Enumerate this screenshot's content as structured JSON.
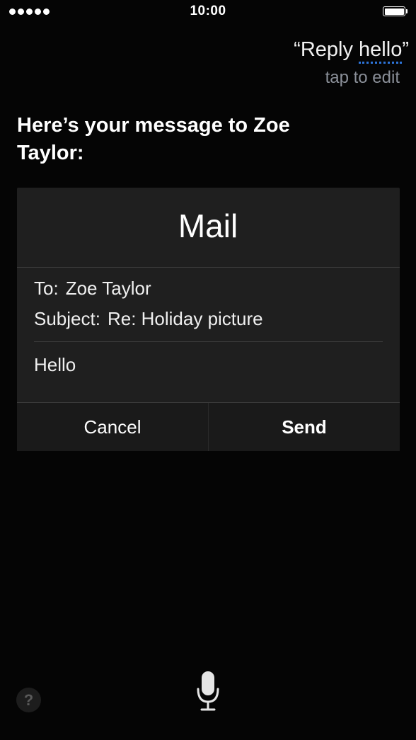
{
  "status_bar": {
    "time": "10:00",
    "signal_bars": 5,
    "battery_level": 1.0,
    "icons": [
      "signal-dots-icon",
      "battery-icon"
    ]
  },
  "siri": {
    "utterance_open_quote": "“",
    "utterance_prefix": "Reply ",
    "utterance_word": "hello",
    "utterance_close_quote": "”",
    "tap_to_edit": "tap to edit",
    "response": "Here’s your message to Zoe Taylor:"
  },
  "mail_card": {
    "title": "Mail",
    "to_label": "To:",
    "to_value": "Zoe Taylor",
    "subject_label": "Subject:",
    "subject_value": "Re: Holiday picture",
    "body": "Hello",
    "cancel_label": "Cancel",
    "send_label": "Send"
  },
  "bottom": {
    "help_label": "?",
    "icons": [
      "help-icon",
      "microphone-icon"
    ]
  },
  "colors": {
    "background": "#050505",
    "card": "#1f1f1f",
    "uncertain_underline": "#2d74d9",
    "secondary_text": "#8a8f98"
  }
}
